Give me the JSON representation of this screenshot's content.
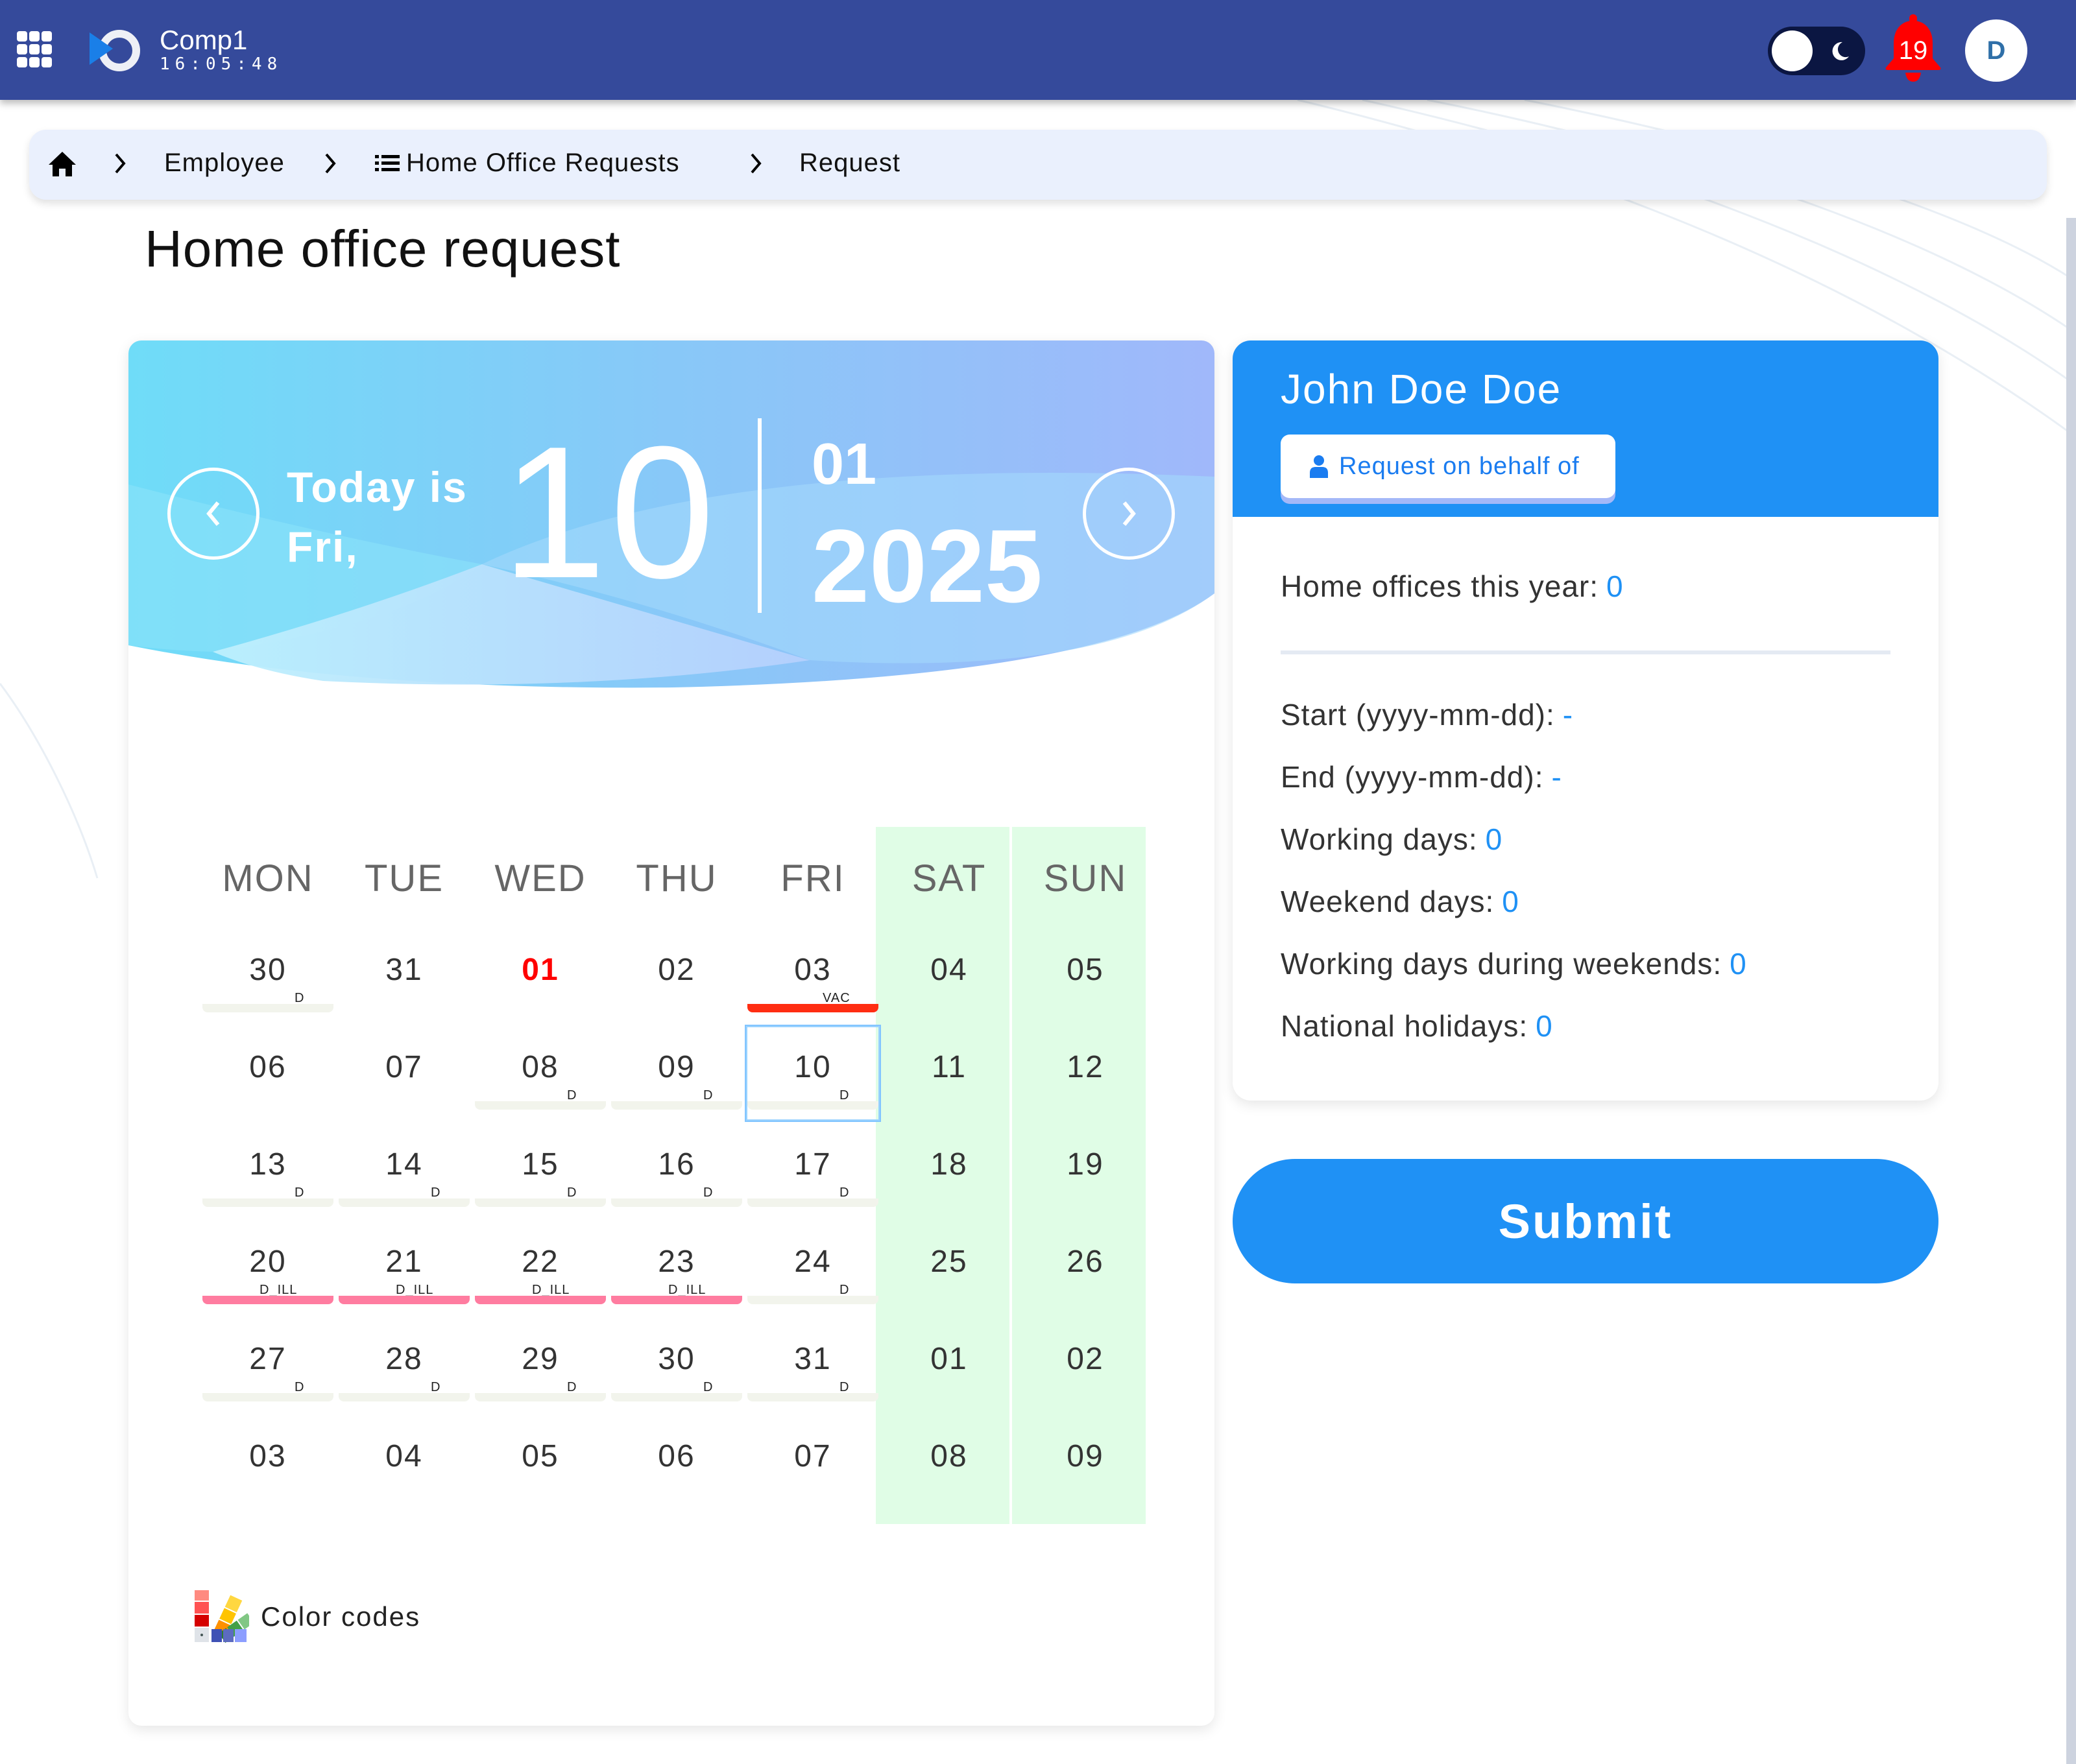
{
  "topbar": {
    "company": "Comp1",
    "clock": "16:05:48",
    "notification_count": "19",
    "avatar_initial": "D",
    "theme_mode": "light"
  },
  "breadcrumb": [
    {
      "label": "Employee"
    },
    {
      "label": "Home Office Requests"
    },
    {
      "label": "Request"
    }
  ],
  "page_title": "Home office request",
  "calendar": {
    "today_label_line1": "Today is",
    "today_label_line2": "Fri,",
    "today_day": "10",
    "month": "01",
    "year": "2025",
    "weekdays": [
      "MON",
      "TUE",
      "WED",
      "THU",
      "FRI",
      "SAT",
      "SUN"
    ],
    "weekend_color": "#e0fde6",
    "selected_day": "10",
    "days": [
      {
        "num": "30",
        "code": "D"
      },
      {
        "num": "31",
        "code": ""
      },
      {
        "num": "01",
        "code": "",
        "holiday": true
      },
      {
        "num": "02",
        "code": ""
      },
      {
        "num": "03",
        "code": "VAC"
      },
      {
        "num": "04",
        "code": "",
        "weekend": true
      },
      {
        "num": "05",
        "code": "",
        "weekend": true
      },
      {
        "num": "06",
        "code": ""
      },
      {
        "num": "07",
        "code": ""
      },
      {
        "num": "08",
        "code": "D"
      },
      {
        "num": "09",
        "code": "D"
      },
      {
        "num": "10",
        "code": "D",
        "selected": true
      },
      {
        "num": "11",
        "code": "",
        "weekend": true
      },
      {
        "num": "12",
        "code": "",
        "weekend": true
      },
      {
        "num": "13",
        "code": "D"
      },
      {
        "num": "14",
        "code": "D"
      },
      {
        "num": "15",
        "code": "D"
      },
      {
        "num": "16",
        "code": "D"
      },
      {
        "num": "17",
        "code": "D"
      },
      {
        "num": "18",
        "code": "",
        "weekend": true
      },
      {
        "num": "19",
        "code": "",
        "weekend": true
      },
      {
        "num": "20",
        "code": "D_ILL"
      },
      {
        "num": "21",
        "code": "D_ILL"
      },
      {
        "num": "22",
        "code": "D_ILL"
      },
      {
        "num": "23",
        "code": "D_ILL"
      },
      {
        "num": "24",
        "code": "D"
      },
      {
        "num": "25",
        "code": "",
        "weekend": true
      },
      {
        "num": "26",
        "code": "",
        "weekend": true
      },
      {
        "num": "27",
        "code": "D"
      },
      {
        "num": "28",
        "code": "D"
      },
      {
        "num": "29",
        "code": "D"
      },
      {
        "num": "30",
        "code": "D"
      },
      {
        "num": "31",
        "code": "D"
      },
      {
        "num": "01",
        "code": "",
        "weekend": true
      },
      {
        "num": "02",
        "code": "",
        "weekend": true
      },
      {
        "num": "03",
        "code": ""
      },
      {
        "num": "04",
        "code": ""
      },
      {
        "num": "05",
        "code": ""
      },
      {
        "num": "06",
        "code": ""
      },
      {
        "num": "07",
        "code": ""
      },
      {
        "num": "08",
        "code": "",
        "weekend": true
      },
      {
        "num": "09",
        "code": "",
        "weekend": true
      }
    ],
    "code_colors": {
      "D": "#f2f4ec",
      "VAC": "#ff2d12",
      "D_ILL": "#ff7ca0"
    },
    "color_codes_label": "Color codes"
  },
  "employee": {
    "name": "John Doe Doe",
    "request_on_behalf_label": "Request on behalf of",
    "stats": {
      "home_offices_this_year": {
        "label": "Home offices this year:",
        "value": "0"
      },
      "start": {
        "label": "Start (yyyy-mm-dd):",
        "value": "-"
      },
      "end": {
        "label": "End (yyyy-mm-dd):",
        "value": "-"
      },
      "working_days": {
        "label": "Working days:",
        "value": "0"
      },
      "weekend_days": {
        "label": "Weekend days:",
        "value": "0"
      },
      "working_days_weekends": {
        "label": "Working days during weekends:",
        "value": "0"
      },
      "national_holidays": {
        "label": "National holidays:",
        "value": "0"
      }
    }
  },
  "submit_label": "Submit",
  "colors": {
    "topbar": "#354a9b",
    "accent": "#1f91f5",
    "holiday": "#ff0000",
    "notification": "#ff0000"
  }
}
